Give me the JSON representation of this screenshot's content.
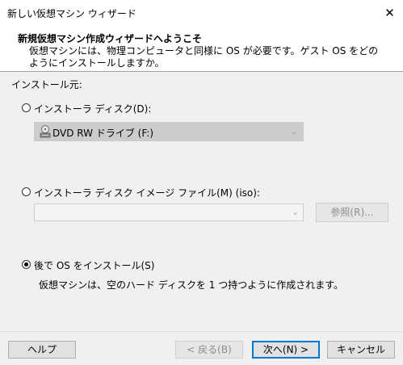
{
  "window": {
    "title": "新しい仮想マシン ウィザード",
    "close_glyph": "✕"
  },
  "header": {
    "title": "新規仮想マシン作成ウィザードへようこそ",
    "description": "仮想マシンには、物理コンピュータと同様に OS が必要です。ゲスト OS をどのようにインストールしますか。"
  },
  "install_source": {
    "label": "インストール元:",
    "options": [
      {
        "label": "インストーラ ディスク(D):",
        "selected": false
      },
      {
        "label": "インストーラ ディスク イメージ ファイル(M) (iso):",
        "selected": false
      },
      {
        "label": "後で OS をインストール(S)",
        "selected": true
      }
    ],
    "disc_drive": {
      "value": "DVD RW ドライブ (F:)",
      "icon": "disc-drive-icon"
    },
    "iso_path": {
      "value": ""
    },
    "browse_label": "参照(R)...",
    "later_description": "仮想マシンは、空のハード ディスクを 1 つ持つように作成されます。"
  },
  "buttons": {
    "help": "ヘルプ",
    "back": "< 戻る(B)",
    "next": "次へ(N) >",
    "cancel": "キャンセル"
  },
  "colors": {
    "accent": "#0078d7",
    "header_bg": "#ffffff",
    "dialog_bg": "#f0f0f0"
  }
}
